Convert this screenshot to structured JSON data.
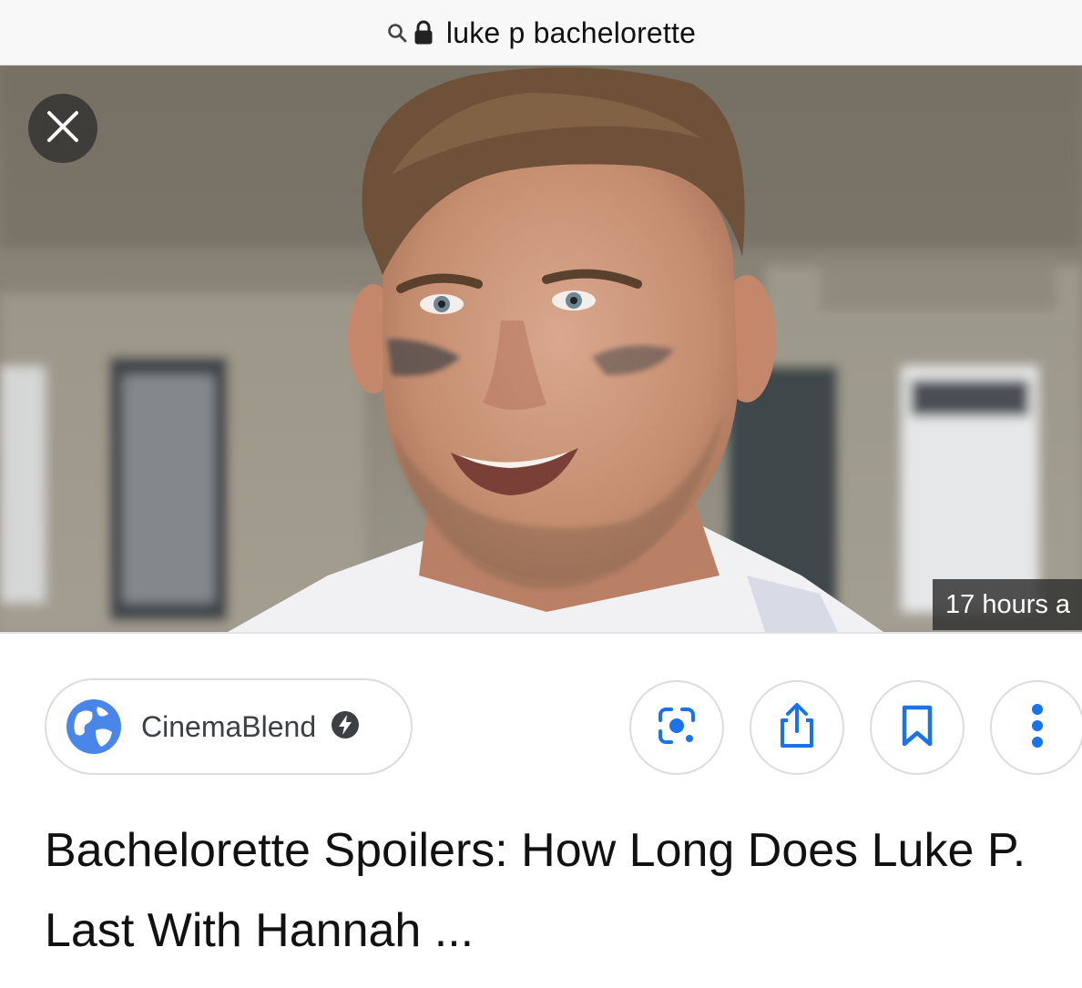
{
  "url_bar": {
    "search_icon": "search-icon",
    "lock_icon": "lock-icon",
    "query": "luke p bachelorette"
  },
  "hero": {
    "close_icon": "close-icon",
    "time_ago": "17 hours a"
  },
  "source": {
    "icon": "globe-icon",
    "name": "CinemaBlend",
    "badge_icon": "amp-lightning-icon"
  },
  "actions": [
    {
      "name": "lens-button",
      "icon": "google-lens-icon"
    },
    {
      "name": "share-button",
      "icon": "share-icon"
    },
    {
      "name": "save-button",
      "icon": "bookmark-icon"
    },
    {
      "name": "more-button",
      "icon": "more-vertical-icon"
    }
  ],
  "headline": "Bachelorette Spoilers: How Long Does Luke P. Last With Hannah ...",
  "colors": {
    "accent_blue": "#1a73e8",
    "text_primary": "#111111",
    "chip_border": "#dadce0"
  }
}
